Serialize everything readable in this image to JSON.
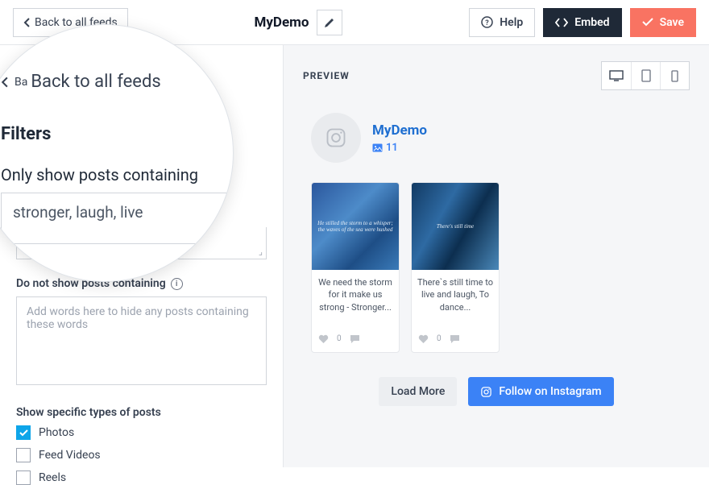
{
  "topbar": {
    "back_label": "Back to all feeds",
    "feed_title": "MyDemo",
    "help_label": "Help",
    "embed_label": "Embed",
    "save_label": "Save"
  },
  "filters": {
    "heading": "Filters",
    "include": {
      "label": "Only show posts containing",
      "value": "stronger, laugh, live"
    },
    "exclude": {
      "label": "Do not show posts containing",
      "placeholder": "Add words here to hide any posts containing these words",
      "value": ""
    },
    "types": {
      "heading": "Show specific types of posts",
      "options": [
        {
          "label": "Photos",
          "checked": true
        },
        {
          "label": "Feed Videos",
          "checked": false
        },
        {
          "label": "Reels",
          "checked": false
        }
      ]
    }
  },
  "preview": {
    "heading": "PREVIEW",
    "profile": {
      "name": "MyDemo",
      "post_count": "11"
    },
    "posts": [
      {
        "thumb_text": "He stilled the storm to a whisper; the waves of the sea were hushed",
        "caption": "We need the storm for it make us strong - Stronger...",
        "likes": "0",
        "comments": "0"
      },
      {
        "thumb_text": "There's still time",
        "caption": "There`s still time to live and laugh, To dance...",
        "likes": "0",
        "comments": "0"
      }
    ],
    "load_more_label": "Load More",
    "follow_label": "Follow on Instagram"
  },
  "colors": {
    "save": "#f97362",
    "dark": "#1f2937",
    "link": "#3b82f6"
  }
}
